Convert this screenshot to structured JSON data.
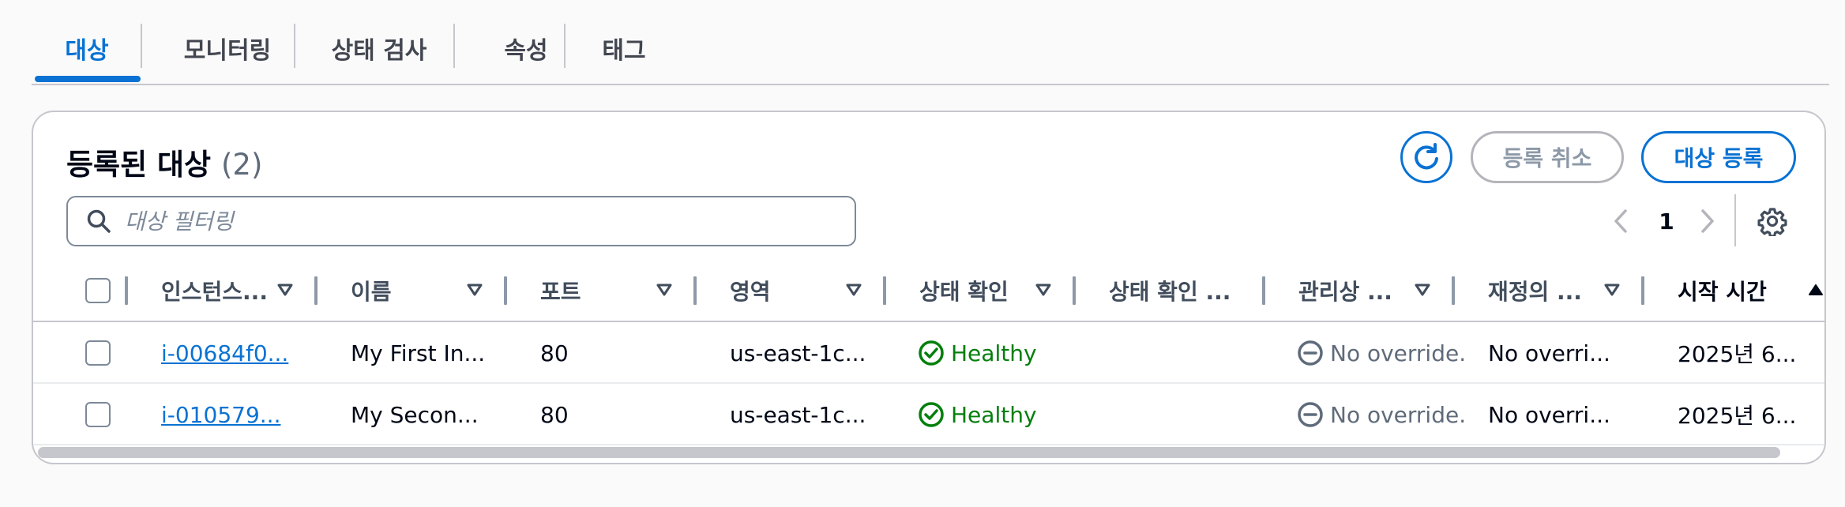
{
  "tabs": [
    {
      "label": "대상",
      "active": true
    },
    {
      "label": "모니터링"
    },
    {
      "label": "상태 검사"
    },
    {
      "label": "속성"
    },
    {
      "label": "태그"
    }
  ],
  "panel": {
    "title": "등록된 대상",
    "count": "(2)",
    "buttons": {
      "refresh_icon": "refresh-icon",
      "deregister": "등록 취소",
      "register": "대상 등록"
    },
    "search": {
      "placeholder": "대상 필터링",
      "value": ""
    },
    "pagination": {
      "page": "1"
    }
  },
  "table": {
    "columns": [
      "인스턴스...",
      "이름",
      "포트",
      "영역",
      "상태 확인",
      "상태 확인 ...",
      "관리상 ...",
      "재정의 ...",
      "시작 시간"
    ],
    "rows": [
      {
        "instance": "i-00684f0...",
        "name": "My First In...",
        "port": "80",
        "zone": "us-east-1c...",
        "health": "Healthy",
        "health_detail": "",
        "admin": "No override.",
        "override": "No overri...",
        "launch": "2025년 6..."
      },
      {
        "instance": "i-010579...",
        "name": "My Secon...",
        "port": "80",
        "zone": "us-east-1c...",
        "health": "Healthy",
        "health_detail": "",
        "admin": "No override.",
        "override": "No overri...",
        "launch": "2025년 6..."
      }
    ]
  },
  "colors": {
    "accent": "#0972d3",
    "healthy": "#037f0c",
    "border": "#c6c6cd"
  }
}
